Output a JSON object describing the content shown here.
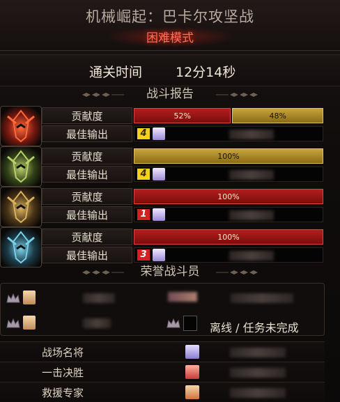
{
  "header": {
    "title": "机械崛起：巴卡尔攻坚战",
    "mode": "困难模式"
  },
  "clear": {
    "label": "通关时间",
    "value": "12分14秒"
  },
  "battle_report": {
    "title": "战斗报告",
    "contribution_label": "贡献度",
    "best_output_label": "最佳输出",
    "players": [
      {
        "portrait_icon": "red-mech-helm-icon",
        "bar": [
          {
            "pct": "52%",
            "color": "red",
            "fraction": 0.52
          },
          {
            "pct": "48%",
            "color": "gold",
            "fraction": 0.48
          }
        ],
        "rank": "4",
        "rank_style": "yellow"
      },
      {
        "portrait_icon": "green-mech-helm-icon",
        "bar": [
          {
            "pct": "100%",
            "color": "gold",
            "fraction": 1.0
          }
        ],
        "rank": "4",
        "rank_style": "yellow"
      },
      {
        "portrait_icon": "gold-mech-helm-icon",
        "bar": [
          {
            "pct": "100%",
            "color": "red",
            "fraction": 1.0
          }
        ],
        "rank": "1",
        "rank_style": "red"
      },
      {
        "portrait_icon": "blue-mech-helm-icon",
        "bar": [
          {
            "pct": "100%",
            "color": "red",
            "fraction": 1.0
          }
        ],
        "rank": "3",
        "rank_style": "red"
      }
    ]
  },
  "honor": {
    "title": "荣誉战斗员",
    "status": "离线 / 任务未完成"
  },
  "awards": [
    {
      "label": "战场名将"
    },
    {
      "label": "一击决胜"
    },
    {
      "label": "救援专家"
    }
  ],
  "colors": {
    "bar_red": "#b21e1e",
    "bar_gold": "#c7a43a",
    "mode_text": "#ff6f58",
    "rank_yellow": "#f4d21b",
    "rank_red": "#d61f1f"
  }
}
